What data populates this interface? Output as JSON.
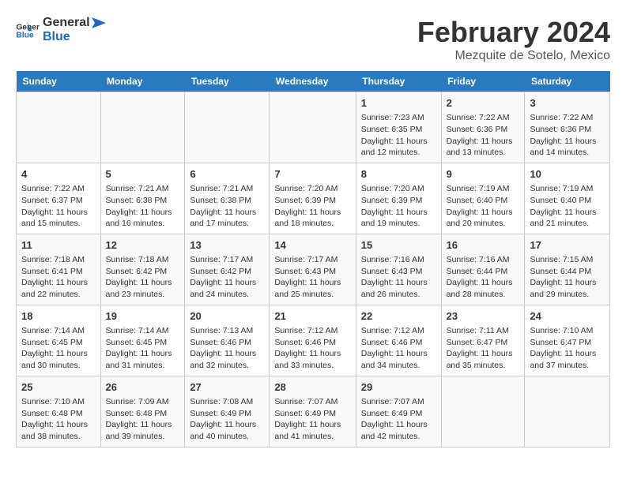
{
  "header": {
    "logo_general": "General",
    "logo_blue": "Blue",
    "title": "February 2024",
    "subtitle": "Mezquite de Sotelo, Mexico"
  },
  "days_of_week": [
    "Sunday",
    "Monday",
    "Tuesday",
    "Wednesday",
    "Thursday",
    "Friday",
    "Saturday"
  ],
  "weeks": [
    [
      {
        "day": "",
        "content": ""
      },
      {
        "day": "",
        "content": ""
      },
      {
        "day": "",
        "content": ""
      },
      {
        "day": "",
        "content": ""
      },
      {
        "day": "1",
        "content": "Sunrise: 7:23 AM\nSunset: 6:35 PM\nDaylight: 11 hours\nand 12 minutes."
      },
      {
        "day": "2",
        "content": "Sunrise: 7:22 AM\nSunset: 6:36 PM\nDaylight: 11 hours\nand 13 minutes."
      },
      {
        "day": "3",
        "content": "Sunrise: 7:22 AM\nSunset: 6:36 PM\nDaylight: 11 hours\nand 14 minutes."
      }
    ],
    [
      {
        "day": "4",
        "content": "Sunrise: 7:22 AM\nSunset: 6:37 PM\nDaylight: 11 hours\nand 15 minutes."
      },
      {
        "day": "5",
        "content": "Sunrise: 7:21 AM\nSunset: 6:38 PM\nDaylight: 11 hours\nand 16 minutes."
      },
      {
        "day": "6",
        "content": "Sunrise: 7:21 AM\nSunset: 6:38 PM\nDaylight: 11 hours\nand 17 minutes."
      },
      {
        "day": "7",
        "content": "Sunrise: 7:20 AM\nSunset: 6:39 PM\nDaylight: 11 hours\nand 18 minutes."
      },
      {
        "day": "8",
        "content": "Sunrise: 7:20 AM\nSunset: 6:39 PM\nDaylight: 11 hours\nand 19 minutes."
      },
      {
        "day": "9",
        "content": "Sunrise: 7:19 AM\nSunset: 6:40 PM\nDaylight: 11 hours\nand 20 minutes."
      },
      {
        "day": "10",
        "content": "Sunrise: 7:19 AM\nSunset: 6:40 PM\nDaylight: 11 hours\nand 21 minutes."
      }
    ],
    [
      {
        "day": "11",
        "content": "Sunrise: 7:18 AM\nSunset: 6:41 PM\nDaylight: 11 hours\nand 22 minutes."
      },
      {
        "day": "12",
        "content": "Sunrise: 7:18 AM\nSunset: 6:42 PM\nDaylight: 11 hours\nand 23 minutes."
      },
      {
        "day": "13",
        "content": "Sunrise: 7:17 AM\nSunset: 6:42 PM\nDaylight: 11 hours\nand 24 minutes."
      },
      {
        "day": "14",
        "content": "Sunrise: 7:17 AM\nSunset: 6:43 PM\nDaylight: 11 hours\nand 25 minutes."
      },
      {
        "day": "15",
        "content": "Sunrise: 7:16 AM\nSunset: 6:43 PM\nDaylight: 11 hours\nand 26 minutes."
      },
      {
        "day": "16",
        "content": "Sunrise: 7:16 AM\nSunset: 6:44 PM\nDaylight: 11 hours\nand 28 minutes."
      },
      {
        "day": "17",
        "content": "Sunrise: 7:15 AM\nSunset: 6:44 PM\nDaylight: 11 hours\nand 29 minutes."
      }
    ],
    [
      {
        "day": "18",
        "content": "Sunrise: 7:14 AM\nSunset: 6:45 PM\nDaylight: 11 hours\nand 30 minutes."
      },
      {
        "day": "19",
        "content": "Sunrise: 7:14 AM\nSunset: 6:45 PM\nDaylight: 11 hours\nand 31 minutes."
      },
      {
        "day": "20",
        "content": "Sunrise: 7:13 AM\nSunset: 6:46 PM\nDaylight: 11 hours\nand 32 minutes."
      },
      {
        "day": "21",
        "content": "Sunrise: 7:12 AM\nSunset: 6:46 PM\nDaylight: 11 hours\nand 33 minutes."
      },
      {
        "day": "22",
        "content": "Sunrise: 7:12 AM\nSunset: 6:46 PM\nDaylight: 11 hours\nand 34 minutes."
      },
      {
        "day": "23",
        "content": "Sunrise: 7:11 AM\nSunset: 6:47 PM\nDaylight: 11 hours\nand 35 minutes."
      },
      {
        "day": "24",
        "content": "Sunrise: 7:10 AM\nSunset: 6:47 PM\nDaylight: 11 hours\nand 37 minutes."
      }
    ],
    [
      {
        "day": "25",
        "content": "Sunrise: 7:10 AM\nSunset: 6:48 PM\nDaylight: 11 hours\nand 38 minutes."
      },
      {
        "day": "26",
        "content": "Sunrise: 7:09 AM\nSunset: 6:48 PM\nDaylight: 11 hours\nand 39 minutes."
      },
      {
        "day": "27",
        "content": "Sunrise: 7:08 AM\nSunset: 6:49 PM\nDaylight: 11 hours\nand 40 minutes."
      },
      {
        "day": "28",
        "content": "Sunrise: 7:07 AM\nSunset: 6:49 PM\nDaylight: 11 hours\nand 41 minutes."
      },
      {
        "day": "29",
        "content": "Sunrise: 7:07 AM\nSunset: 6:49 PM\nDaylight: 11 hours\nand 42 minutes."
      },
      {
        "day": "",
        "content": ""
      },
      {
        "day": "",
        "content": ""
      }
    ]
  ]
}
